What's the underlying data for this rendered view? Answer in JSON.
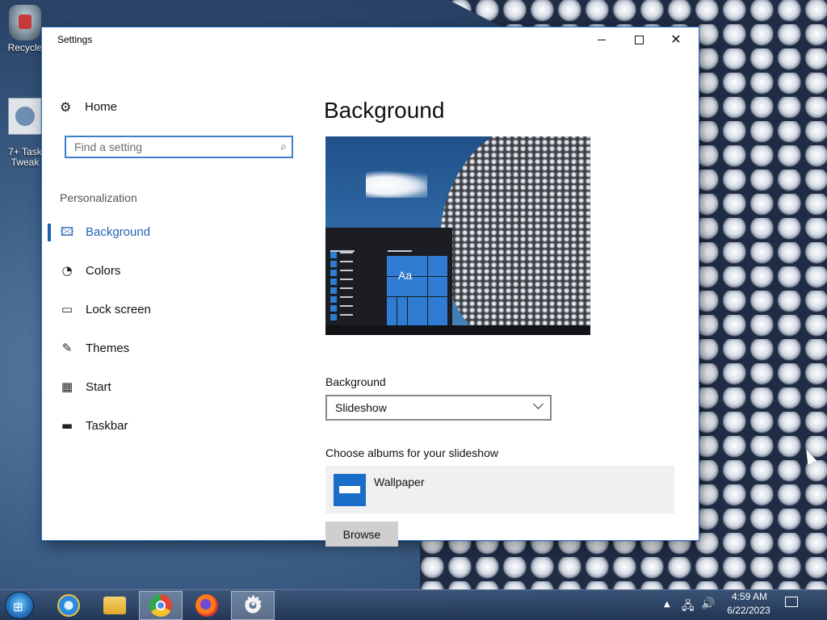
{
  "desktop": {
    "icons": [
      {
        "label": "Recycle"
      },
      {
        "label": "7+ Task\nTweak"
      }
    ]
  },
  "window": {
    "title": "Settings",
    "controls": {
      "minimize": "—",
      "maximize": "☐",
      "close": "✕"
    }
  },
  "nav": {
    "home_label": "Home",
    "search_placeholder": "Find a setting",
    "section": "Personalization",
    "items": [
      {
        "label": "Background",
        "icon": "picture-icon",
        "active": true
      },
      {
        "label": "Colors",
        "icon": "palette-icon"
      },
      {
        "label": "Lock screen",
        "icon": "lock-screen-icon"
      },
      {
        "label": "Themes",
        "icon": "brush-icon"
      },
      {
        "label": "Start",
        "icon": "start-grid-icon"
      },
      {
        "label": "Taskbar",
        "icon": "taskbar-icon"
      }
    ]
  },
  "main": {
    "title": "Background",
    "preview_sample": "Aa",
    "background_label": "Background",
    "background_value": "Slideshow",
    "albums_label": "Choose albums for your slideshow",
    "album_name": "Wallpaper",
    "browse_label": "Browse"
  },
  "taskbar": {
    "apps": [
      "internet-explorer-icon",
      "file-explorer-icon",
      "chrome-icon",
      "firefox-icon",
      "settings-gear-icon"
    ],
    "time": "4:59 AM",
    "date": "6/22/2023"
  },
  "colors": {
    "accent": "#1f62b4",
    "window_border": "#2b79d6",
    "album_tile": "#1a6ec7"
  }
}
